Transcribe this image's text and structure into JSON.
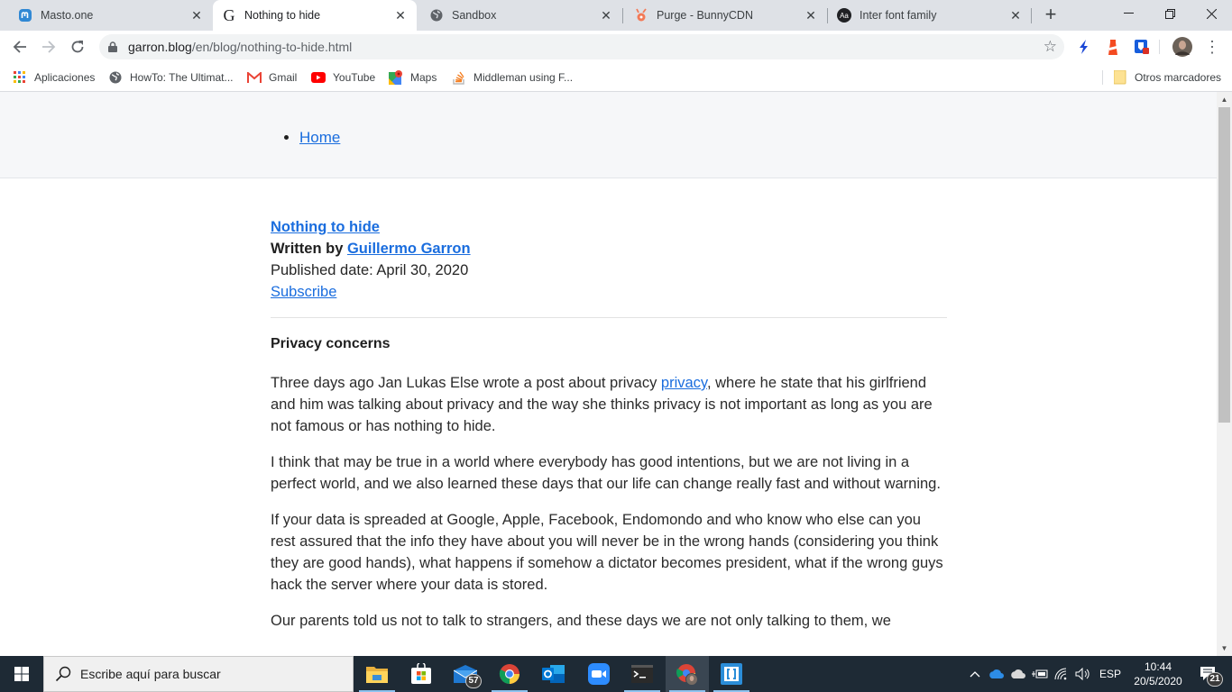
{
  "browser": {
    "tabs": [
      {
        "title": "Masto.one",
        "icon": "mastodon-icon",
        "active": false
      },
      {
        "title": "Nothing to hide",
        "icon": "g-letter-icon",
        "active": true
      },
      {
        "title": "Sandbox",
        "icon": "globe-icon",
        "active": false
      },
      {
        "title": "Purge - BunnyCDN",
        "icon": "bunnycdn-icon",
        "active": false
      },
      {
        "title": "Inter font family",
        "icon": "aa-icon",
        "active": false
      }
    ],
    "tab_close_glyph": "✕",
    "new_tab_glyph": "+",
    "window_controls": {
      "minimize": "—",
      "restore": "❐",
      "close": "✕"
    },
    "url": {
      "host": "garron.blog",
      "path": "/en/blog/nothing-to-hide.html"
    },
    "bookmark_star": "☆",
    "menu_glyph": "⋮",
    "bookmarks": [
      {
        "label": "Aplicaciones",
        "icon": "apps-grid-icon"
      },
      {
        "label": "HowTo: The Ultimat...",
        "icon": "globe-icon"
      },
      {
        "label": "Gmail",
        "icon": "gmail-icon"
      },
      {
        "label": "YouTube",
        "icon": "youtube-icon"
      },
      {
        "label": "Maps",
        "icon": "maps-icon"
      },
      {
        "label": "Middleman using F...",
        "icon": "stackoverflow-icon"
      }
    ],
    "other_bookmarks": "Otros marcadores"
  },
  "page": {
    "nav": [
      {
        "label": "Home"
      }
    ],
    "post": {
      "title": "Nothing to hide",
      "written_by_label": "Written by",
      "author": "Guillermo Garron",
      "published": "Published date: April 30, 2020",
      "subscribe": "Subscribe",
      "section_heading": "Privacy concerns",
      "p1_before": "Three days ago Jan Lukas Else wrote a post about privacy ",
      "p1_link": "privacy",
      "p1_after": ", where he state that his girlfriend and him was talking about privacy and the way she thinks privacy is not important as long as you are not famous or has nothing to hide.",
      "p2": "I think that may be true in a world where everybody has good intentions, but we are not living in a perfect world, and we also learned these days that our life can change really fast and without warning.",
      "p3": "If your data is spreaded at Google, Apple, Facebook, Endomondo and who know who else can you rest assured that the info they have about you will never be in the wrong hands (considering you think they are good hands), what happens if somehow a dictator becomes president, what if the wrong guys hack the server where your data is stored.",
      "p4": "Our parents told us not to talk to strangers, and these days we are not only talking to them, we"
    }
  },
  "taskbar": {
    "search_placeholder": "Escribe aquí para buscar",
    "apps": [
      {
        "name": "file-explorer",
        "badge": null
      },
      {
        "name": "microsoft-store",
        "badge": null
      },
      {
        "name": "mail",
        "badge": "57"
      },
      {
        "name": "chrome",
        "badge": null
      },
      {
        "name": "outlook",
        "badge": null
      },
      {
        "name": "zoom",
        "badge": null
      },
      {
        "name": "terminal",
        "badge": null
      },
      {
        "name": "chrome-profile",
        "badge": null
      },
      {
        "name": "brackets",
        "badge": null
      }
    ],
    "language": "ESP",
    "time": "10:44",
    "date": "20/5/2020",
    "notifications": "21"
  },
  "colors": {
    "link": "#1a6dde",
    "header_bg": "#f6f7f9",
    "taskbar_bg": "#1e2a35",
    "tabstrip_bg": "#dee1e6"
  }
}
